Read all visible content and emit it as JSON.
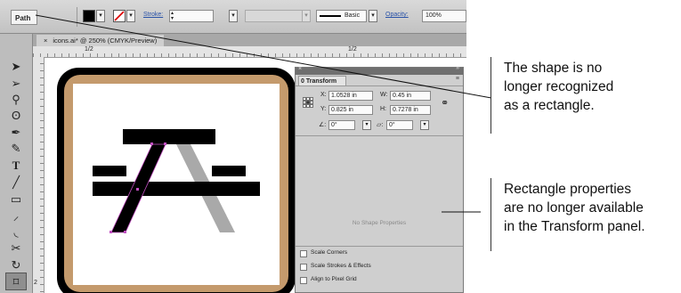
{
  "control_bar": {
    "selection_label": "Path",
    "stroke_label": "Stroke:",
    "brush_label": "Basic",
    "opacity_label": "Opacity:",
    "opacity_value": "100%"
  },
  "document": {
    "tab_title": "icons.ai* @ 250% (CMYK/Preview)",
    "ruler_marks": [
      "1/2",
      "1/2",
      "2"
    ]
  },
  "transform_panel": {
    "tab_label": "0 Transform",
    "x_label": "X:",
    "x_value": "1.0528 in",
    "y_label": "Y:",
    "y_value": "0.825 in",
    "w_label": "W:",
    "w_value": "0.45 in",
    "h_label": "H:",
    "h_value": "0.7278 in",
    "rotate_value": "0°",
    "shear_value": "0°",
    "empty_message": "No Shape Properties",
    "checkboxes": [
      "Scale Corners",
      "Scale Strokes & Effects",
      "Align to Pixel Grid"
    ]
  },
  "annotations": {
    "top": [
      "The shape is no",
      "longer recognized",
      "as a rectangle."
    ],
    "bottom": [
      "Rectangle properties",
      "are no longer available",
      "in the Transform panel."
    ]
  },
  "colors": {
    "artboard_border": "#c49a6c",
    "selection_anchor": "#c24fc2"
  },
  "icons": [
    "selection-tool-icon",
    "direct-selection-tool-icon",
    "zoom-icon",
    "lasso-icon",
    "pen-tool-icon",
    "pencil-icon",
    "type-tool-icon",
    "line-tool-icon",
    "rectangle-tool-icon",
    "paintbrush-icon",
    "blob-brush-icon",
    "scissors-icon",
    "rotate-icon",
    "free-transform-icon"
  ]
}
